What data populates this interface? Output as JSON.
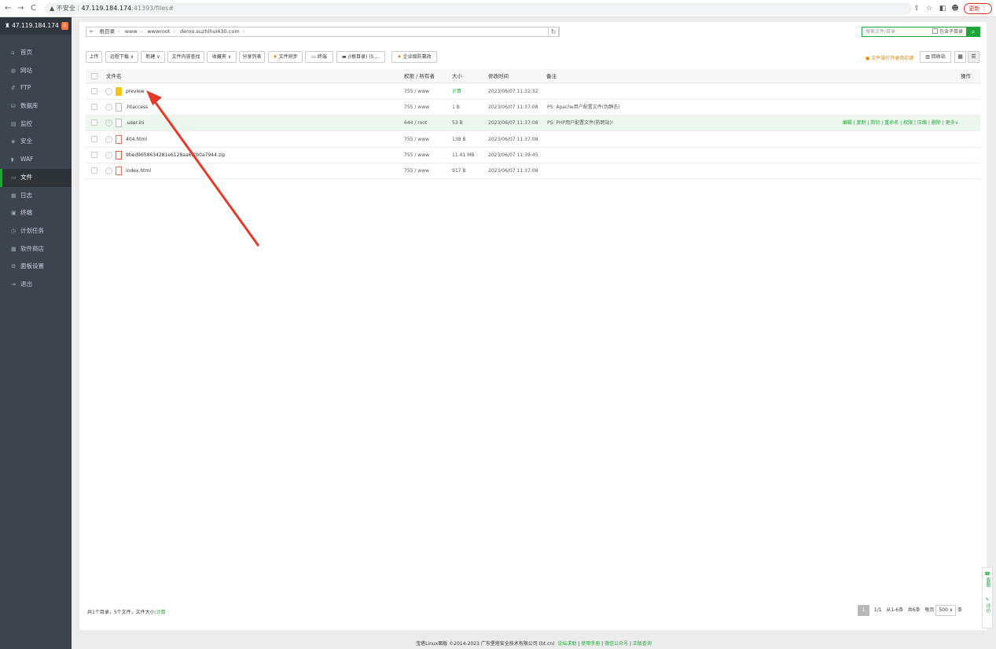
{
  "browser": {
    "back": "←",
    "forward": "→",
    "reload": "C",
    "warning": "▲ 不安全",
    "host": "47.119.184.174",
    "path": ":41393/files#",
    "update_label": "更新 ⋮"
  },
  "sidebar": {
    "server": "47.119.184.174",
    "badge": "0",
    "items": [
      {
        "label": "首页",
        "icon": "⌂"
      },
      {
        "label": "网站",
        "icon": "◍"
      },
      {
        "label": "FTP",
        "icon": "⇵"
      },
      {
        "label": "数据库",
        "icon": "⛁"
      },
      {
        "label": "监控",
        "icon": "▤"
      },
      {
        "label": "安全",
        "icon": "◈"
      },
      {
        "label": "WAF",
        "icon": "◗"
      },
      {
        "label": "文件",
        "icon": "▭"
      },
      {
        "label": "日志",
        "icon": "▦"
      },
      {
        "label": "终端",
        "icon": "▣"
      },
      {
        "label": "计划任务",
        "icon": "◷"
      },
      {
        "label": "软件商店",
        "icon": "▩"
      },
      {
        "label": "面板设置",
        "icon": "⚙"
      },
      {
        "label": "退出",
        "icon": "⇥"
      }
    ]
  },
  "breadcrumb": {
    "back": "←",
    "items": [
      "根目录",
      "www",
      "wwwroot",
      "demo.suzhihui430.com"
    ]
  },
  "search": {
    "placeholder": "搜索文件/目录",
    "sub_label": "包含子目录",
    "btn": "⌕"
  },
  "toolbar": {
    "upload": "上传",
    "remote_download": "远程下载 ∨",
    "new": "新建 ∨",
    "content_search": "文件内容查找",
    "favorites": "收藏夹 ∨",
    "share_list": "分享列表",
    "file_sync": "文件同步",
    "terminal": "终端",
    "disk": "/(根目录) (5....",
    "tamper": "企业级防篡改",
    "tip": "文件操作开便用右键",
    "recycle": "回收站",
    "view_grid": "▦",
    "view_list": "☰"
  },
  "table": {
    "headers": {
      "name": "文件名",
      "perm": "权限 / 所有者",
      "size": "大小",
      "mtime": "修改时间",
      "note": "备注",
      "ops": "操作"
    },
    "rows": [
      {
        "name": "preview",
        "type": "folder",
        "perm": "755 / www",
        "size": "计算",
        "mtime": "2023/06/07 11:32:32",
        "note": ""
      },
      {
        "name": ".htaccess",
        "type": "doc",
        "perm": "755 / www",
        "size": "1 B",
        "mtime": "2023/06/07 11:37:08",
        "note": "PS: Apache用户配置文件(伪静态)"
      },
      {
        "name": ".user.ini",
        "type": "doc",
        "perm": "644 / root",
        "size": "53 B",
        "mtime": "2023/06/07 11:37:08",
        "note": "PS: PHP用户配置文件(防跨站)!"
      },
      {
        "name": "404.html",
        "type": "html",
        "perm": "755 / www",
        "size": "138 B",
        "mtime": "2023/06/07 11:37:08",
        "note": ""
      },
      {
        "name": "9bed9658634281e6128aa6f2b0a7944.zip",
        "type": "zip",
        "perm": "755 / www",
        "size": "11.41 MB",
        "mtime": "2023/06/07 11:39:45",
        "note": ""
      },
      {
        "name": "index.html",
        "type": "html",
        "perm": "755 / www",
        "size": "917 B",
        "mtime": "2023/06/07 11:37:08",
        "note": ""
      }
    ],
    "row_ops": "编辑 | 复制 | 剪切 | 重命名 | 权限 | 压缩 | 删除 | 更多∨"
  },
  "footer": {
    "summary": "共1个目录，5个文件，文件大小:",
    "calc": "计算",
    "page": "1",
    "page_total": "1/1",
    "range": "从1-6条",
    "count": "共6条",
    "per_page_label": "每页",
    "per_page": "500 ∨",
    "unit": "条"
  },
  "copyright": {
    "text": "宝塔Linux面板 ©2014-2023 广东堡塔安全技术有限公司 (bt.cn)",
    "links": [
      "论坛求助",
      "使用手册",
      "微信公众号",
      "正版查询"
    ]
  },
  "float": {
    "service": "客服",
    "review": "评价"
  },
  "colors": {
    "accent": "#20a53a",
    "sidebar": "#3c444d",
    "annotation": "#e53a2a"
  }
}
